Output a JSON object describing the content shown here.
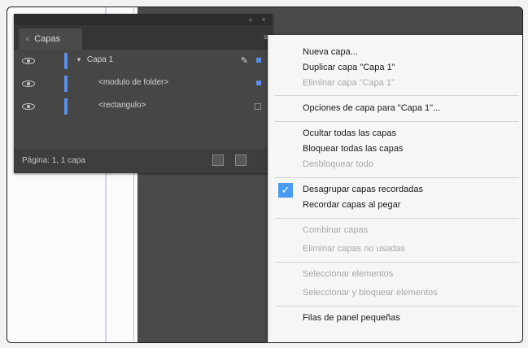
{
  "panel": {
    "tab_label": "Capas",
    "layers": [
      {
        "label": "Capa 1",
        "type": "layer"
      },
      {
        "label": "<modulo de folder>",
        "type": "sublayer"
      },
      {
        "label": "<rectangulo>",
        "type": "sublayer"
      }
    ],
    "footer_text": "Página: 1, 1 capa"
  },
  "menu": {
    "items": [
      {
        "label": "Nueva capa...",
        "enabled": true
      },
      {
        "label": "Duplicar capa \"Capa 1\"",
        "enabled": true
      },
      {
        "label": "Eliminar capa \"Capa 1\"",
        "enabled": false
      },
      {
        "label": "Opciones de capa para \"Capa 1\"...",
        "enabled": true
      },
      {
        "label": "Ocultar todas las capas",
        "enabled": true
      },
      {
        "label": "Bloquear todas las capas",
        "enabled": true
      },
      {
        "label": "Desbloquear todo",
        "enabled": false
      },
      {
        "label": "Desagrupar capas recordadas",
        "enabled": true,
        "checked": true
      },
      {
        "label": "Recordar capas al pegar",
        "enabled": true
      },
      {
        "label": "Combinar capas",
        "enabled": false
      },
      {
        "label": "Eliminar capas no usadas",
        "enabled": false
      },
      {
        "label": "Seleccionar elementos",
        "enabled": false
      },
      {
        "label": "Seleccionar y bloquear elementos",
        "enabled": false
      },
      {
        "label": "Filas de panel pequeñas",
        "enabled": true
      }
    ]
  },
  "colors": {
    "layer_accent": "#5a8fe8",
    "check_accent": "#4a9cf0"
  }
}
